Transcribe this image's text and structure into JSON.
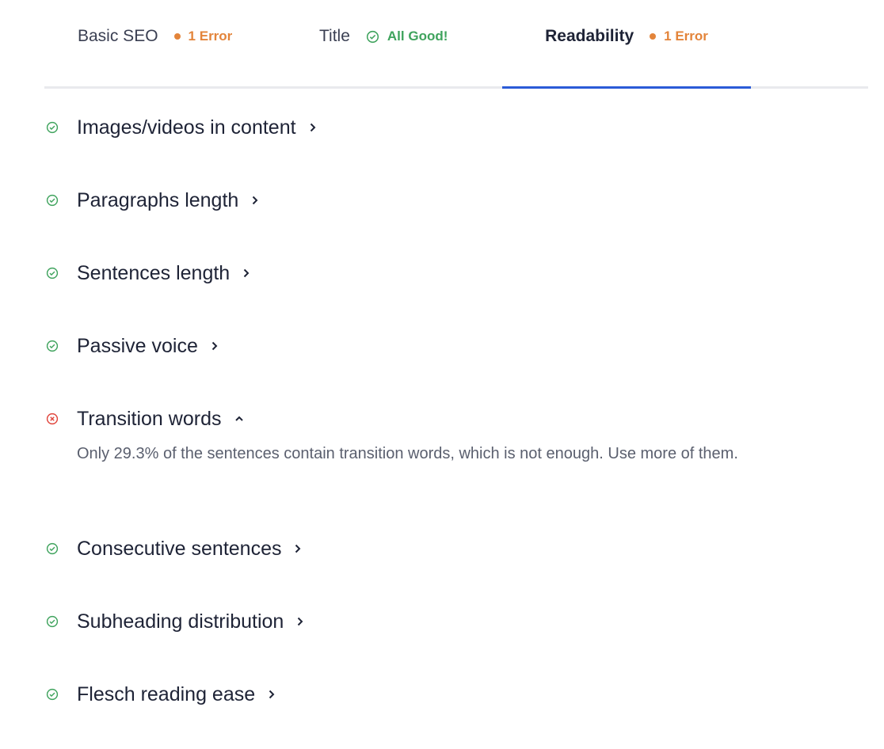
{
  "tabs": [
    {
      "label": "Basic SEO",
      "status": "error",
      "badge": "1 Error",
      "active": false
    },
    {
      "label": "Title",
      "status": "ok",
      "badge": "All Good!",
      "active": false
    },
    {
      "label": "Readability",
      "status": "error",
      "badge": "1 Error",
      "active": true
    }
  ],
  "colors": {
    "ok": "#3fa35d",
    "error": "#e3843a",
    "fail": "#e0453c",
    "active_tab": "#2a5bd7"
  },
  "checks": [
    {
      "label": "Images/videos in content",
      "status": "ok",
      "expanded": false,
      "icon": "check-circle-icon"
    },
    {
      "label": "Paragraphs length",
      "status": "ok",
      "expanded": false,
      "icon": "check-circle-icon"
    },
    {
      "label": "Sentences length",
      "status": "ok",
      "expanded": false,
      "icon": "check-circle-icon"
    },
    {
      "label": "Passive voice",
      "status": "ok",
      "expanded": false,
      "icon": "check-circle-icon"
    },
    {
      "label": "Transition words",
      "status": "fail",
      "expanded": true,
      "icon": "x-circle-icon",
      "description": "Only 29.3% of the sentences contain transition words, which is not enough. Use more of them."
    },
    {
      "label": "Consecutive sentences",
      "status": "ok",
      "expanded": false,
      "icon": "check-circle-icon"
    },
    {
      "label": "Subheading distribution",
      "status": "ok",
      "expanded": false,
      "icon": "check-circle-icon"
    },
    {
      "label": "Flesch reading ease",
      "status": "ok",
      "expanded": false,
      "icon": "check-circle-icon"
    }
  ]
}
